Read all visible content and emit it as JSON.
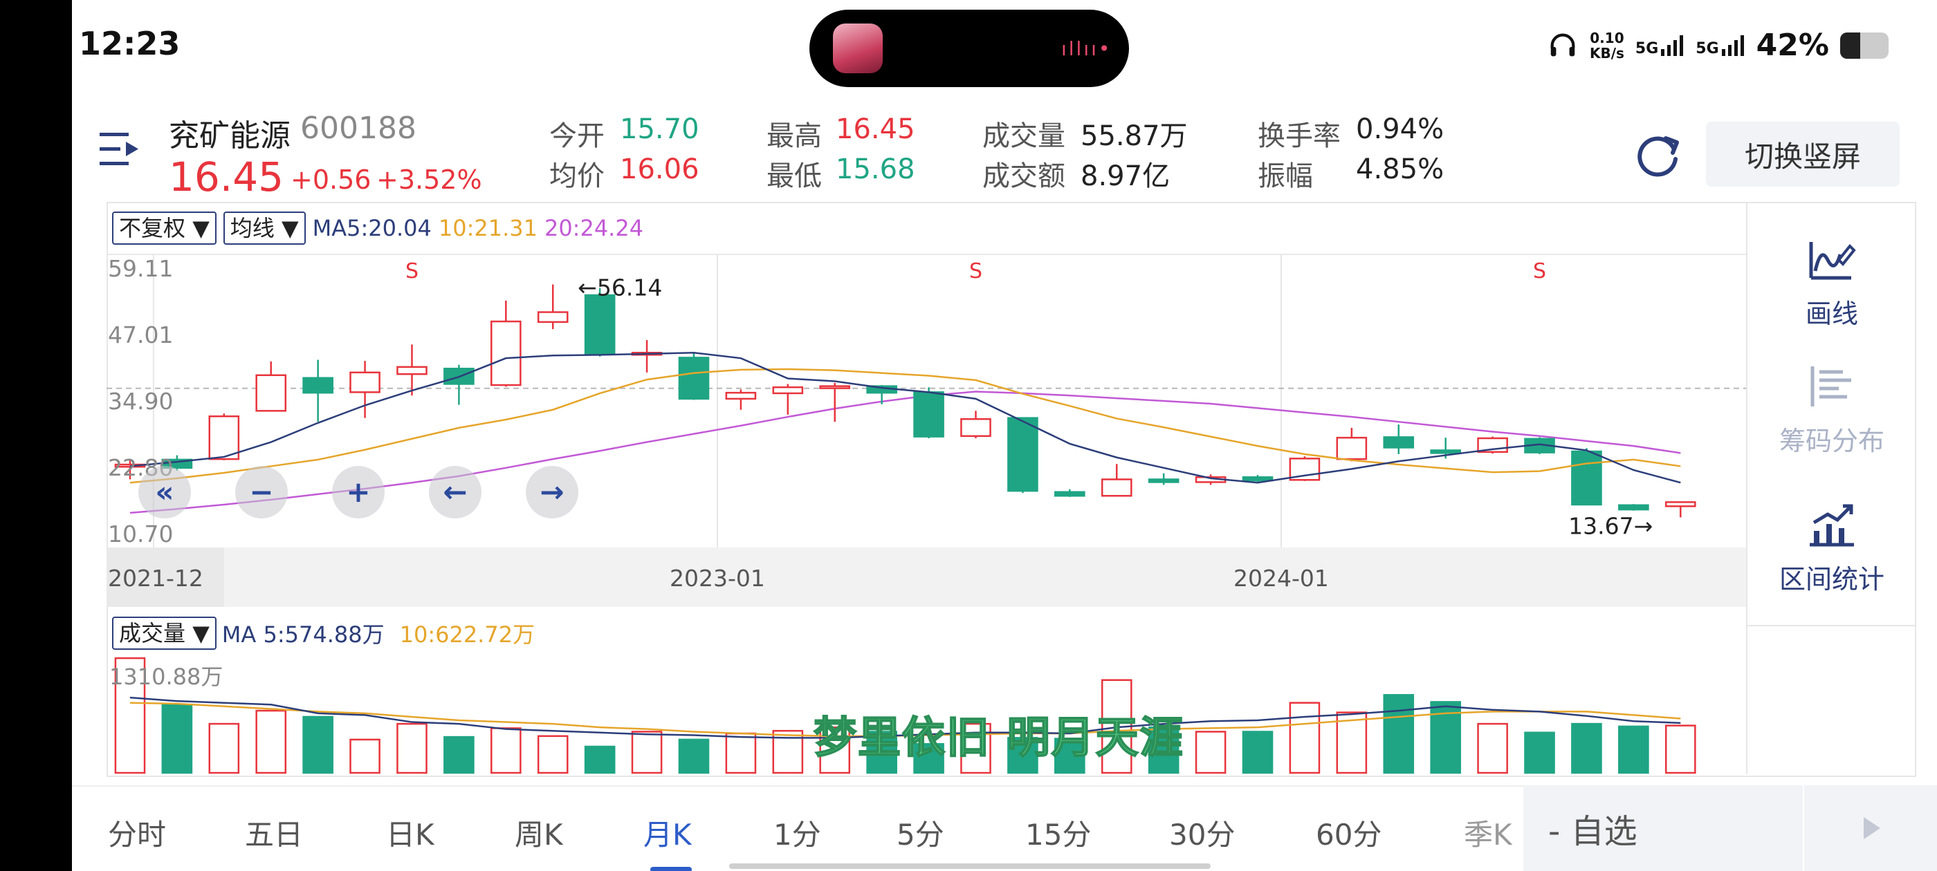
{
  "status_bar": {
    "time": "12:23",
    "net_speed_value": "0.10",
    "net_speed_unit": "KB/s",
    "sig1": "5G",
    "sig2": "5G",
    "battery": "42%",
    "battery_level": 0.42
  },
  "stock": {
    "name": "兖矿能源",
    "code": "600188",
    "price": "16.45",
    "change": "+0.56",
    "change_pct": "+3.52%"
  },
  "quote": {
    "open_label": "今开",
    "open": "15.70",
    "avg_label": "均价",
    "avg": "16.06",
    "high_label": "最高",
    "high": "16.45",
    "low_label": "最低",
    "low": "15.68",
    "vol_label": "成交量",
    "vol": "55.87万",
    "amount_label": "成交额",
    "amount": "8.97亿",
    "turnover_label": "换手率",
    "turnover": "0.94%",
    "amplitude_label": "振幅",
    "amplitude": "4.85%"
  },
  "switch_label": "切换竖屏",
  "kline_header": {
    "adjust": "不复权",
    "adjust_arrow": "▼",
    "ma_select": "均线",
    "ma_arrow": "▼",
    "ma5": "MA5:20.04",
    "ma10": "10:21.31",
    "ma20": "20:24.24"
  },
  "y_ticks": [
    "59.11",
    "47.01",
    "34.90",
    "22.80",
    "10.70"
  ],
  "x_ticks": [
    "2021-12",
    "2023-01",
    "2024-01"
  ],
  "annot_high": "←56.14",
  "annot_low": "13.67→",
  "s_marker": "S",
  "zoom_buttons": [
    "«",
    "−",
    "+",
    "←",
    "→"
  ],
  "vol_header": {
    "select": "成交量",
    "arrow": "▼",
    "ma5": "MA 5:574.88万",
    "ma10": "10:622.72万",
    "max": "1310.88万"
  },
  "watermark": "梦里依旧 明月天涯",
  "side": {
    "draw": "画线",
    "chips": "筹码分布",
    "stats": "区间统计"
  },
  "tabs": [
    "分时",
    "五日",
    "日K",
    "周K",
    "月K",
    "1分",
    "5分",
    "15分",
    "30分",
    "60分",
    "季K"
  ],
  "active_tab": "月K",
  "add_watch": "- 自选",
  "colors": {
    "up": "#e8343c",
    "down": "#1fa584",
    "ma5": "#2c3e7a",
    "ma10": "#e6a52a",
    "ma20": "#c259d6",
    "accent": "#2c5cc8"
  },
  "chart_data": {
    "type": "candlestick",
    "period": "monthly",
    "ylim": [
      10.7,
      59.11
    ],
    "categories": [
      "2021-12",
      "2022-01",
      "2022-02",
      "2022-03",
      "2022-04",
      "2022-05",
      "2022-06",
      "2022-07",
      "2022-08",
      "2022-09",
      "2022-10",
      "2022-11",
      "2022-12",
      "2023-01",
      "2023-02",
      "2023-03",
      "2023-04",
      "2023-05",
      "2023-06",
      "2023-07",
      "2023-08",
      "2023-09",
      "2023-10",
      "2023-11",
      "2023-12",
      "2024-01",
      "2024-02",
      "2024-03",
      "2024-04",
      "2024-05",
      "2024-06",
      "2024-07",
      "2024-08",
      "2024-09"
    ],
    "candles": [
      {
        "o": 22.9,
        "c": 23.3,
        "h": 24.1,
        "l": 20.6
      },
      {
        "o": 24.2,
        "c": 22.7,
        "h": 25.0,
        "l": 22.2
      },
      {
        "o": 24.3,
        "c": 32.1,
        "h": 32.6,
        "l": 24.1
      },
      {
        "o": 33.1,
        "c": 39.6,
        "h": 42.1,
        "l": 33.1
      },
      {
        "o": 39.1,
        "c": 36.4,
        "h": 42.4,
        "l": 31.1
      },
      {
        "o": 36.5,
        "c": 40.1,
        "h": 42.2,
        "l": 31.8
      },
      {
        "o": 39.8,
        "c": 41.1,
        "h": 45.2,
        "l": 35.9
      },
      {
        "o": 40.8,
        "c": 38.0,
        "h": 41.5,
        "l": 34.2
      },
      {
        "o": 37.8,
        "c": 49.4,
        "h": 53.2,
        "l": 37.5
      },
      {
        "o": 49.3,
        "c": 51.1,
        "h": 56.14,
        "l": 48.0
      },
      {
        "o": 54.2,
        "c": 43.4,
        "h": 55.5,
        "l": 43.0
      },
      {
        "o": 43.4,
        "c": 43.7,
        "h": 46.0,
        "l": 40.1
      },
      {
        "o": 42.8,
        "c": 35.3,
        "h": 43.6,
        "l": 35.1
      },
      {
        "o": 35.3,
        "c": 36.4,
        "h": 37.0,
        "l": 33.3
      },
      {
        "o": 36.3,
        "c": 37.4,
        "h": 38.0,
        "l": 32.4
      },
      {
        "o": 37.3,
        "c": 37.6,
        "h": 38.2,
        "l": 31.1
      },
      {
        "o": 37.6,
        "c": 36.4,
        "h": 37.8,
        "l": 34.3
      },
      {
        "o": 36.5,
        "c": 28.4,
        "h": 37.4,
        "l": 28.1
      },
      {
        "o": 28.5,
        "c": 31.6,
        "h": 33.1,
        "l": 28.1
      },
      {
        "o": 31.8,
        "c": 18.5,
        "h": 31.9,
        "l": 18.1
      },
      {
        "o": 18.3,
        "c": 17.6,
        "h": 18.8,
        "l": 17.4
      },
      {
        "o": 17.6,
        "c": 20.6,
        "h": 23.4,
        "l": 17.5
      },
      {
        "o": 20.6,
        "c": 20.1,
        "h": 21.7,
        "l": 19.6
      },
      {
        "o": 20.1,
        "c": 21.0,
        "h": 21.5,
        "l": 19.6
      },
      {
        "o": 21.0,
        "c": 20.4,
        "h": 21.4,
        "l": 20.0
      },
      {
        "o": 20.5,
        "c": 24.4,
        "h": 24.8,
        "l": 20.3
      },
      {
        "o": 24.3,
        "c": 28.2,
        "h": 30.0,
        "l": 23.9
      },
      {
        "o": 28.3,
        "c": 26.4,
        "h": 30.6,
        "l": 25.2
      },
      {
        "o": 25.9,
        "c": 25.4,
        "h": 28.2,
        "l": 24.4
      },
      {
        "o": 25.6,
        "c": 28.1,
        "h": 28.4,
        "l": 25.3
      },
      {
        "o": 28.0,
        "c": 25.5,
        "h": 28.3,
        "l": 25.2
      },
      {
        "o": 25.7,
        "c": 16.0,
        "h": 26.3,
        "l": 15.9
      },
      {
        "o": 15.9,
        "c": 15.1,
        "h": 16.1,
        "l": 14.9
      },
      {
        "o": 15.7,
        "c": 16.45,
        "h": 16.45,
        "l": 13.67
      }
    ],
    "ma5": [
      23.0,
      23.8,
      24.7,
      27.4,
      30.9,
      34.1,
      36.8,
      39.3,
      42.7,
      43.2,
      43.3,
      43.5,
      43.7,
      42.7,
      39.0,
      38.5,
      37.3,
      36.5,
      35.3,
      31.2,
      27.1,
      24.6,
      22.7,
      20.8,
      20.0,
      21.3,
      22.5,
      23.9,
      25.0,
      26.1,
      27.0,
      25.9,
      22.3,
      20.0
    ],
    "ma10": [
      20.0,
      20.8,
      21.8,
      23.0,
      24.2,
      26.0,
      28.0,
      30.0,
      31.5,
      33.3,
      36.3,
      38.8,
      40.0,
      40.6,
      40.7,
      40.5,
      40.0,
      39.5,
      38.7,
      36.2,
      34.0,
      31.7,
      30.1,
      28.4,
      26.7,
      25.2,
      24.1,
      23.3,
      22.6,
      21.9,
      22.1,
      23.5,
      24.2,
      23.0
    ],
    "ma20": [
      14.5,
      15.2,
      16.0,
      16.9,
      17.9,
      18.9,
      20.0,
      21.2,
      22.7,
      24.3,
      25.8,
      27.4,
      28.9,
      30.4,
      32.0,
      33.5,
      34.8,
      35.9,
      36.6,
      36.3,
      35.9,
      35.4,
      34.9,
      34.4,
      33.6,
      32.8,
      32.0,
      31.1,
      30.2,
      29.3,
      28.5,
      27.6,
      26.7,
      25.4
    ],
    "volume": [
      1310,
      780,
      560,
      710,
      640,
      380,
      560,
      410,
      510,
      420,
      300,
      470,
      380,
      450,
      480,
      520,
      470,
      330,
      560,
      400,
      390,
      1060,
      520,
      470,
      470,
      800,
      690,
      890,
      810,
      560,
      460,
      560,
      530,
      540
    ],
    "vol_ma5": [
      860,
      820,
      800,
      780,
      680,
      660,
      580,
      560,
      500,
      480,
      460,
      440,
      430,
      410,
      400,
      400,
      420,
      440,
      460,
      460,
      450,
      520,
      560,
      590,
      600,
      640,
      670,
      710,
      760,
      720,
      700,
      650,
      590,
      570
    ],
    "vol_ma10": [
      800,
      790,
      760,
      730,
      700,
      680,
      640,
      600,
      580,
      560,
      520,
      500,
      470,
      450,
      430,
      420,
      420,
      430,
      440,
      450,
      450,
      480,
      500,
      510,
      520,
      560,
      600,
      640,
      680,
      700,
      700,
      700,
      660,
      620
    ],
    "vol_max": 1310.88
  }
}
